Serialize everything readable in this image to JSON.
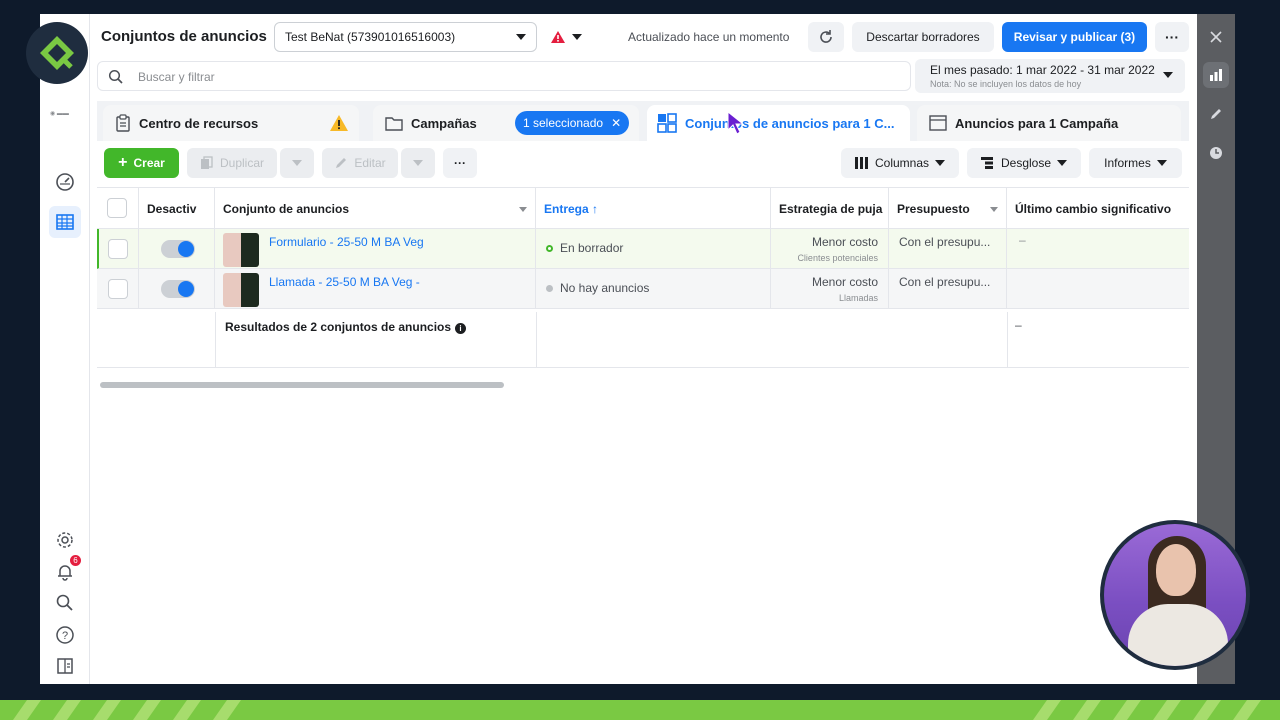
{
  "topbar": {
    "title": "Conjuntos de anuncios",
    "account": "Test BeNat (573901016516003)",
    "updated": "Actualizado hace un momento",
    "discard": "Descartar borradores",
    "publish": "Revisar y publicar (3)"
  },
  "search": {
    "placeholder": "Buscar y filtrar"
  },
  "date_range": {
    "label": "El mes pasado: 1 mar 2022 - 31 mar 2022",
    "note": "Nota: No se incluyen los datos de hoy"
  },
  "tabs": [
    {
      "label": "Centro de recursos"
    },
    {
      "label": "Campañas"
    },
    {
      "label": "Conjuntos de anuncios para 1 C..."
    },
    {
      "label": "Anuncios para 1 Campaña"
    }
  ],
  "selection_chip": "1 seleccionado",
  "toolbar": {
    "create": "Crear",
    "duplicate": "Duplicar",
    "edit": "Editar",
    "columns": "Columnas",
    "breakdown": "Desglose",
    "reports": "Informes"
  },
  "table": {
    "headers": {
      "toggle": "Desactiv",
      "name": "Conjunto de anuncios",
      "delivery": "Entrega",
      "bid": "Estrategia de puja",
      "budget": "Presupuesto",
      "last_change": "Último cambio significativo"
    },
    "rows": [
      {
        "name": "Formulario - 25-50 M BA Veg",
        "status": "En borrador",
        "bid": "Menor costo",
        "bid_sub": "Clientes potenciales",
        "budget": "Con el presupu...",
        "last_change": "–"
      },
      {
        "name": "Llamada - 25-50 M BA Veg -",
        "status": "No hay anuncios",
        "bid": "Menor costo",
        "bid_sub": "Llamadas",
        "budget": "Con el presupu...",
        "last_change": ""
      }
    ],
    "summary": "Resultados de 2 conjuntos de anuncios",
    "summary_last_change": "–"
  },
  "notifications_count": "6",
  "colors": {
    "primary": "#1877f2",
    "create_green": "#42b72a",
    "brand_green": "#7ac943",
    "warning": "#e41e3f"
  }
}
